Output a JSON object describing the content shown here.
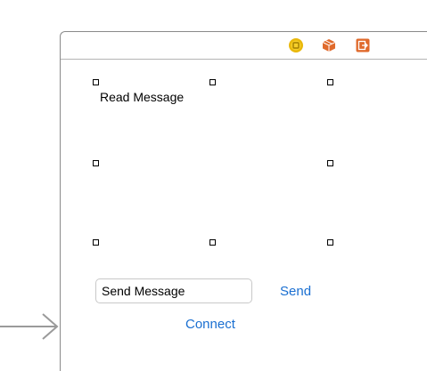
{
  "scene": {
    "dock_icons": [
      {
        "name": "view-controller-icon",
        "color": "#e9b80c"
      },
      {
        "name": "first-responder-icon",
        "color": "#e06a2c"
      },
      {
        "name": "exit-icon",
        "color": "#e06a2c"
      }
    ]
  },
  "view": {
    "read_label": "Read Message",
    "send_field": {
      "value": "Send Message",
      "placeholder": ""
    },
    "send_button_label": "Send",
    "connect_button_label": "Connect"
  },
  "colors": {
    "accent": "#1a6fd1",
    "frame_border": "#8a8a8a",
    "entry_arrow": "#9a9a9a"
  }
}
